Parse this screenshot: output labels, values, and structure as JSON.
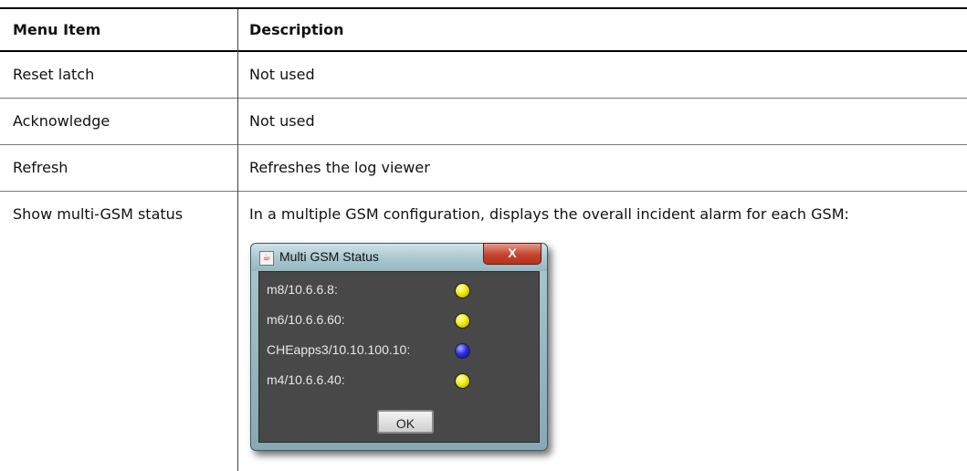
{
  "table": {
    "headers": {
      "menu_item": "Menu Item",
      "description": "Description"
    },
    "rows": [
      {
        "item": "Reset latch",
        "description": "Not used"
      },
      {
        "item": "Acknowledge",
        "description": "Not used"
      },
      {
        "item": "Refresh",
        "description": "Refreshes the log viewer"
      },
      {
        "item": "Show multi-GSM status",
        "description": "In a multiple GSM configuration, displays the overall incident alarm for each GSM:"
      }
    ]
  },
  "dialog": {
    "title": "Multi GSM Status",
    "close_glyph": "X",
    "entries": [
      {
        "label": "m8/10.6.6.8:",
        "status": "yellow"
      },
      {
        "label": "m6/10.6.6.60:",
        "status": "yellow"
      },
      {
        "label": "CHEapps3/10.10.100.10:",
        "status": "blue"
      },
      {
        "label": "m4/10.6.6.40:",
        "status": "yellow"
      }
    ],
    "ok_label": "OK"
  }
}
